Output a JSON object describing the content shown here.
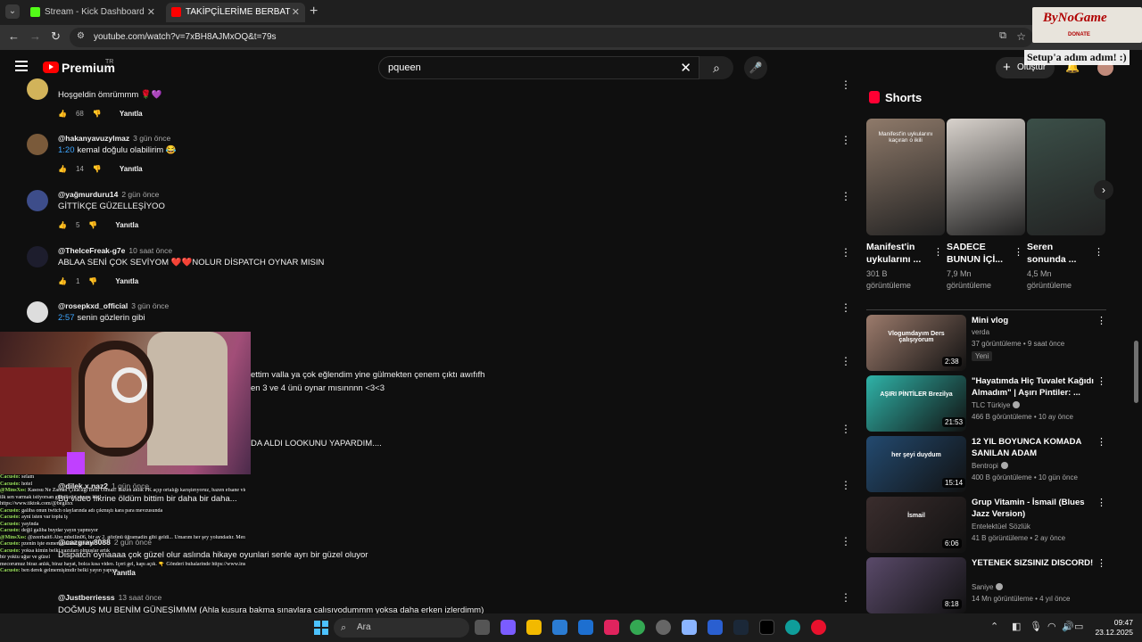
{
  "browser": {
    "tabs": [
      {
        "title": "Stream - Kick Dashboard",
        "color": "#53fc18"
      },
      {
        "title": "TAKİPÇİLERİME BERBAT TEMAL",
        "color": "#ff0000"
      }
    ],
    "url": "youtube.com/watch?v=7xBH8AJMxOQ&t=79s"
  },
  "yt_header": {
    "logo_text": "Premium",
    "logo_country": "TR",
    "search_query": "pqueen",
    "create_label": "Oluştur"
  },
  "comments": [
    {
      "user": "",
      "time": "",
      "timestamp": "",
      "text": "Hoşgeldin ömrümmm 🌹💜",
      "likes": "68",
      "reply": "Yanıtla",
      "color": "#d2b35a"
    },
    {
      "user": "@hakanyavuzylmaz",
      "time": "3 gün önce",
      "timestamp": "1:20",
      "text": "kemal doğulu olabilirim 😂",
      "likes": "14",
      "reply": "Yanıtla",
      "color": "#7a5a3a"
    },
    {
      "user": "@yağmurduru14",
      "time": "2 gün önce",
      "timestamp": "",
      "text": "GİTTİKÇE GÜZELLEŞİYOO",
      "likes": "5",
      "reply": "Yanıtla",
      "color": "#3d4d8a"
    },
    {
      "user": "@TheIceFreak-g7e",
      "time": "10 saat önce",
      "timestamp": "",
      "text": "ABLAA SENİ ÇOK SEVİYOM ❤️❤️NOLUR DİSPATCH OYNAR MISIN",
      "likes": "1",
      "reply": "Yanıtla",
      "color": "#1d1d2d"
    },
    {
      "user": "@rosepkxd_official",
      "time": "3 gün önce",
      "timestamp": "2:57",
      "text": "senin gözlerin gibi",
      "likes": "",
      "reply": "",
      "color": "#dddddd"
    }
  ],
  "partial_comments": [
    {
      "text": "ettim valla ya çok eğlendim yine gülmekten çenem çıktı awıfıfh"
    },
    {
      "text": "en 3 ve 4 ünü oynar mısınnnn <3<3"
    },
    {
      "text": "DA ALDI LOOKUNU YAPARDIM...."
    },
    {
      "user": "@dilek.x.naz2",
      "time": "1 gün önce",
      "text": "Bu video fikrine öldüm bittim bir daha bir daha..."
    },
    {
      "user": "@cazgray8088",
      "time": "2 gün önce",
      "text": "Dispatch oynaaaa çok güzel olur aslında hikaye oyunlari senle ayrı bir güzel oluyor",
      "reply": "Yanıtla"
    },
    {
      "user": "@Justberriesss",
      "time": "13 saat önce",
      "text": "DOĞMUŞ MU BENİM GÜNEŞİMMM (Ahla kusura bakma sınavlara calısıvodummm yoksa daha erken izlerdimm)"
    }
  ],
  "chat_lines": [
    {
      "user": "Cacusto:",
      "msg": "selam"
    },
    {
      "user": "Cacusto:",
      "msg": "hotel"
    },
    {
      "user": "@MinsXss:",
      "msg": "Kasosu Ne Zaman Çıkacağı Belli Olmaz! Bazen anlık PK açıp ortalığı karıştırıyoruz, bazen efsane videolar çekiyoruz. Takip et ve Bekle:"
    },
    {
      "user": "",
      "msg": "ilk sen varmak istiyorsan gündüzün yayını kaç!"
    },
    {
      "user": "",
      "msg": "https://www.tiktok.com/@begllxx"
    },
    {
      "user": "Cacusto:",
      "msg": "galiba onun twitch olaylarında adı çıkmıştı kara para mevzusunda"
    },
    {
      "user": "Cacusto:",
      "msg": "ayni isten var toplu iş"
    },
    {
      "user": "Cacusto:",
      "msg": "yayinda"
    },
    {
      "user": "Cacusto:",
      "msg": "değil galiba buydar yayın yapmıyor"
    },
    {
      "user": "@MinsXss:",
      "msg": "@zeerbait6 Abo mbellin06, bir ay 2. gözünü üğramadin gibi geldi... Umarım her şey yolundadır. Merak ettim seni."
    },
    {
      "user": "Cacusto:",
      "msg": "pzenin işte esmeraldadaki girerim"
    },
    {
      "user": "Cacusto:",
      "msg": "yoksa kimin belki yazuları olmuşlar artık"
    },
    {
      "user": "",
      "msg": "bir yoktu uğur ve güzel"
    },
    {
      "user": "",
      "msg": "mecorumuz biraz anlık, biraz hayat, bolca kısa video. İçeri gel, kapı açık. 👇 Gönderi buhalarinde https://www.instagram.com/begllxx_/"
    },
    {
      "user": "Cacusto:",
      "msg": "ben derek gelmemişimdir belki yayın yapıyo"
    }
  ],
  "shorts": {
    "heading": "Shorts",
    "items": [
      {
        "title": "Manifest'in\nuykularını ...",
        "views": "301 B\ngörüntüleme",
        "overlay": "Manifest'in uykularını kaçıran o ikili",
        "color": "#8f7a6a"
      },
      {
        "title": "SADECE\nBUNUN İÇİ...",
        "views": "7,9 Mn\ngörüntüleme",
        "overlay": "",
        "color": "#d8d2cc"
      },
      {
        "title": "Seren\nsonunda ...",
        "views": "4,5 Mn\ngörüntüleme",
        "overlay": "",
        "color": "#3b4f48"
      }
    ]
  },
  "videos": [
    {
      "title": "Mini vlog",
      "channel": "verda",
      "verified": false,
      "meta": "37 görüntüleme • 9 saat önce",
      "badge": "Yeni",
      "duration": "2:38",
      "color": "#9c7b6c",
      "overlay": "Vlogumdayım Ders çalışıyorum"
    },
    {
      "title": "\"Hayatımda Hiç Tuvalet Kağıdı Almadım\" | Aşırı Pintiler: ...",
      "channel": "TLC Türkiye",
      "verified": true,
      "meta": "466 B görüntüleme • 10 ay önce",
      "badge": "",
      "duration": "21:53",
      "color": "#2fb3a8",
      "overlay": "AŞIRI PİNTİLER Brezilya"
    },
    {
      "title": "12 YIL BOYUNCA KOMADA SANILAN ADAM",
      "channel": "Bentropi",
      "verified": true,
      "meta": "400 B görüntüleme • 10 gün önce",
      "badge": "",
      "duration": "15:14",
      "color": "#234a70",
      "overlay": "her şeyi duydum"
    },
    {
      "title": "Grup Vitamin - İsmail (Blues Jazz Version)",
      "channel": "Entelektüel Sözlük",
      "verified": false,
      "meta": "41 B görüntüleme • 2 ay önce",
      "badge": "",
      "duration": "6:06",
      "color": "#3a2d2d",
      "overlay": "İsmail"
    },
    {
      "title": "YETENEK SIZSINIZ DISCORD!",
      "channel": "Saniye",
      "verified": true,
      "meta": "14 Mn görüntüleme • 4 yıl önce",
      "badge": "",
      "duration": "8:18",
      "color": "#5a4a6a",
      "overlay": ""
    }
  ],
  "stream_overlay": {
    "brand": "ByNoGame",
    "donate": "DONATE",
    "setup_text": "Setup'a adım adım! :)"
  },
  "taskbar": {
    "search_placeholder": "Ara",
    "time": "09:47",
    "date": "23.12.2025"
  }
}
